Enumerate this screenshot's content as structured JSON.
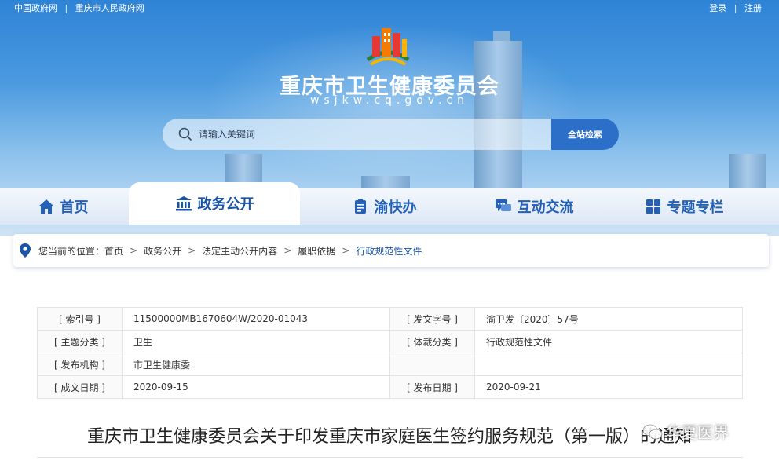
{
  "topbar": {
    "left_links": [
      "中国政府网",
      "重庆市人民政府网"
    ],
    "separator": "|",
    "login": "登录",
    "register": "注册"
  },
  "site": {
    "title": "重庆市卫生健康委员会",
    "domain": "wsjkw.cq.gov.cn"
  },
  "search": {
    "placeholder": "请输入关键词",
    "button": "全站检索"
  },
  "nav": {
    "items": [
      {
        "label": "首页",
        "icon": "home-icon"
      },
      {
        "label": "政务公开",
        "icon": "government-building-icon"
      },
      {
        "label": "渝快办",
        "icon": "clipboard-icon"
      },
      {
        "label": "互动交流",
        "icon": "chat-bubbles-icon"
      },
      {
        "label": "专题专栏",
        "icon": "grid-icon"
      }
    ],
    "active": "政务公开"
  },
  "breadcrumb": {
    "prefix": "您当前的位置：",
    "items": [
      "首页",
      "政务公开",
      "法定主动公开内容",
      "履职依据",
      "行政规范性文件"
    ],
    "arrow": ">"
  },
  "info": {
    "rows": [
      [
        "[ 索引号 ]",
        "11500000MB1670604W/2020-01043",
        "[ 发文字号 ]",
        "渝卫发〔2020〕57号"
      ],
      [
        "[ 主题分类 ]",
        "卫生",
        "[ 体裁分类 ]",
        "行政规范性文件"
      ],
      [
        "[ 发布机构 ]",
        "市卫生健康委",
        "",
        ""
      ],
      [
        "[ 成文日期 ]",
        "2020-09-15",
        "[ 发布日期 ]",
        "2020-09-21"
      ]
    ]
  },
  "document": {
    "title": "重庆市卫生健康委员会关于印发重庆市家庭医生签约服务规范（第一版）的通知"
  },
  "watermark": {
    "text": "华夏医界"
  },
  "colors": {
    "nav_text": "#2460b5",
    "search_button": "#2b6fc8",
    "current_crumb": "#1a54a8"
  }
}
